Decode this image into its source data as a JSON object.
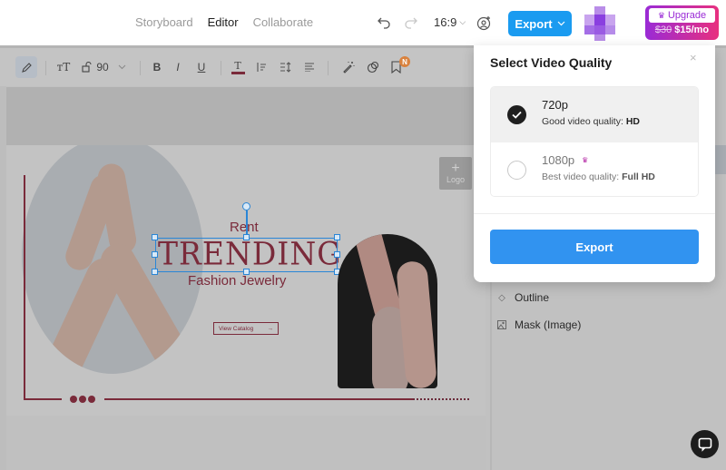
{
  "header": {
    "nav": [
      {
        "label": "Storyboard",
        "active": false
      },
      {
        "label": "Editor",
        "active": true
      },
      {
        "label": "Collaborate",
        "active": false
      }
    ],
    "aspect_ratio": "16:9",
    "export_label": "Export",
    "upgrade": {
      "label": "Upgrade",
      "old_price": "$30",
      "new_price": "$15/mo"
    }
  },
  "toolbar": {
    "font_size": "90",
    "bold": "B",
    "italic": "I",
    "underline": "U",
    "text_color_glyph": "T",
    "notification_badge": "N",
    "icons": [
      "pencil-icon",
      "text-size-icon",
      "lock-icon",
      "chevron-down-icon",
      "bold-icon",
      "italic-icon",
      "underline-icon",
      "text-color-icon",
      "align-icon",
      "line-spacing-icon",
      "paragraph-icon",
      "magic-wand-icon",
      "shapes-icon",
      "bookmark-icon"
    ]
  },
  "canvas": {
    "rent": "Rent",
    "trending": "TRENDING",
    "fashion": "Fashion Jewelry",
    "view_catalog": "View Catalog",
    "view_catalog_arrow": "→",
    "logo_label": "Logo",
    "logo_plus": "+"
  },
  "side_panel": {
    "items": [
      {
        "label": "Outline",
        "icon": "diamond-icon"
      },
      {
        "label": "Mask (Image)",
        "icon": "image-mask-icon"
      }
    ]
  },
  "modal": {
    "title": "Select Video Quality",
    "options": [
      {
        "title": "720p",
        "desc": "Good video quality:",
        "desc_bold": "HD",
        "selected": true,
        "premium": false
      },
      {
        "title": "1080p",
        "desc": "Best video quality:",
        "desc_bold": "Full HD",
        "selected": false,
        "premium": true
      }
    ],
    "export_label": "Export",
    "crown": "♛",
    "close": "×"
  },
  "colors": {
    "brand_blue": "#1a9bf0",
    "modal_export_blue": "#3193f0",
    "accent_maroon": "#7a2a3a",
    "upgrade_gradient_start": "#9a2bd6",
    "upgrade_gradient_end": "#e8307f",
    "selection_blue": "#2a86d6"
  }
}
